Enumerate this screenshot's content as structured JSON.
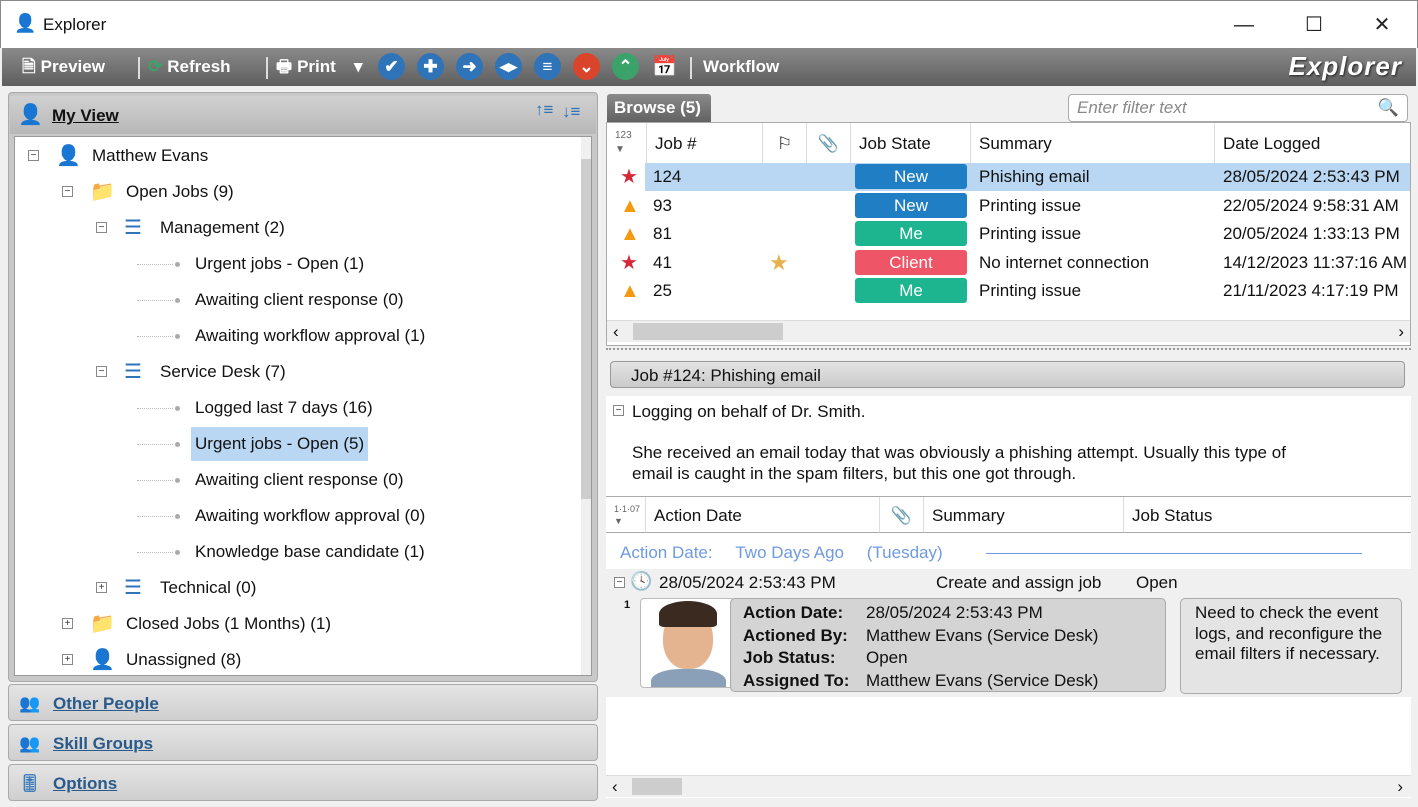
{
  "window": {
    "title": "Explorer",
    "minimize": "—",
    "maximize": "☐",
    "close": "✕"
  },
  "toolbar": {
    "preview": "Preview",
    "refresh": "Refresh",
    "print": "Print",
    "print_dropdown": "▾",
    "workflow": "Workflow",
    "brand": "Explorer",
    "icon_buttons": [
      {
        "name": "check",
        "glyph": "✔",
        "color": "#2f73b8"
      },
      {
        "name": "plus",
        "glyph": "✚",
        "color": "#2f73b8"
      },
      {
        "name": "arrow-right",
        "glyph": "➜",
        "color": "#2f73b8"
      },
      {
        "name": "split",
        "glyph": "◂▸",
        "color": "#2f73b8"
      },
      {
        "name": "list",
        "glyph": "≡",
        "color": "#2f73b8"
      },
      {
        "name": "chevron-down",
        "glyph": "⌄",
        "color": "#d9442b"
      },
      {
        "name": "chevron-up",
        "glyph": "⌃",
        "color": "#3ba36a"
      }
    ]
  },
  "left": {
    "my_view": "My View",
    "tree": [
      {
        "label": "Matthew Evans",
        "level": 0,
        "expander": "−",
        "icon": "user-icon"
      },
      {
        "label": "Open Jobs (9)",
        "level": 1,
        "expander": "−",
        "icon": "folder-icon"
      },
      {
        "label": "Management (2)",
        "level": 2,
        "expander": "−",
        "icon": "queue-icon"
      },
      {
        "label": "Urgent jobs - Open (1)",
        "level": 3
      },
      {
        "label": "Awaiting client response (0)",
        "level": 3
      },
      {
        "label": "Awaiting workflow approval (1)",
        "level": 3
      },
      {
        "label": "Service Desk (7)",
        "level": 2,
        "expander": "−",
        "icon": "queue-icon"
      },
      {
        "label": "Logged last 7 days (16)",
        "level": 3
      },
      {
        "label": "Urgent jobs - Open (5)",
        "level": 3,
        "selected": true
      },
      {
        "label": "Awaiting client response (0)",
        "level": 3
      },
      {
        "label": "Awaiting workflow approval (0)",
        "level": 3
      },
      {
        "label": "Knowledge base candidate (1)",
        "level": 3
      },
      {
        "label": "Technical (0)",
        "level": 2,
        "expander": "+",
        "icon": "queue-icon"
      },
      {
        "label": "Closed Jobs (1 Months) (1)",
        "level": 1,
        "expander": "+",
        "icon": "folder-icon"
      },
      {
        "label": "Unassigned (8)",
        "level": 1,
        "expander": "+",
        "icon": "unassigned-user-icon"
      }
    ],
    "nav": [
      "Other People",
      "Skill Groups",
      "Options"
    ]
  },
  "browse": {
    "tab": "Browse (5)",
    "filter_placeholder": "Enter filter text",
    "columns": [
      "Job #",
      "Job State",
      "Summary",
      "Date Logged"
    ],
    "sort_glyph": "123",
    "rows": [
      {
        "priority": "star",
        "job": "124",
        "flag": "",
        "state": "New",
        "state_color": "#1f7ec4",
        "summary": "Phishing email",
        "date": "28/05/2024 2:53:43 PM",
        "selected": true
      },
      {
        "priority": "triangle",
        "job": "93",
        "flag": "",
        "state": "New",
        "state_color": "#1f7ec4",
        "summary": "Printing issue",
        "date": "22/05/2024 9:58:31 AM"
      },
      {
        "priority": "triangle",
        "job": "81",
        "flag": "",
        "state": "Me",
        "state_color": "#1db590",
        "summary": "Printing issue",
        "date": "20/05/2024 1:33:13 PM"
      },
      {
        "priority": "star",
        "job": "41",
        "flag": "★",
        "state": "Client",
        "state_color": "#ee5566",
        "summary": "No internet connection",
        "date": "14/12/2023 11:37:16 AM"
      },
      {
        "priority": "triangle",
        "job": "25",
        "flag": "",
        "state": "Me",
        "state_color": "#1db590",
        "summary": "Printing issue",
        "date": "21/11/2023 4:17:19 PM"
      }
    ]
  },
  "job": {
    "header": "Job #124: Phishing email",
    "desc_line1": "Logging on behalf of Dr. Smith.",
    "desc_line2": "She received an email today that was obviously a phishing attempt.  Usually this type of",
    "desc_line3": "email is caught in the spam filters, but this one got through."
  },
  "actions": {
    "columns": [
      "Action Date",
      "Summary",
      "Job Status"
    ],
    "sort_glyph": "1·1·07",
    "group": {
      "label": "Action Date:",
      "value": "Two Days Ago",
      "day": "(Tuesday)"
    },
    "row": {
      "date": "28/05/2024 2:53:43 PM",
      "summary": "Create and assign job",
      "status": "Open",
      "index": "1"
    },
    "detail": {
      "action_date_label": "Action Date:",
      "action_date": "28/05/2024 2:53:43 PM",
      "actioned_by_label": "Actioned By:",
      "actioned_by": "Matthew Evans (Service Desk)",
      "job_status_label": "Job Status:",
      "job_status": "Open",
      "assigned_to_label": "Assigned To:",
      "assigned_to": "Matthew Evans (Service Desk)"
    },
    "note": "Need to check the event logs, and reconfigure the email filters if necessary."
  }
}
